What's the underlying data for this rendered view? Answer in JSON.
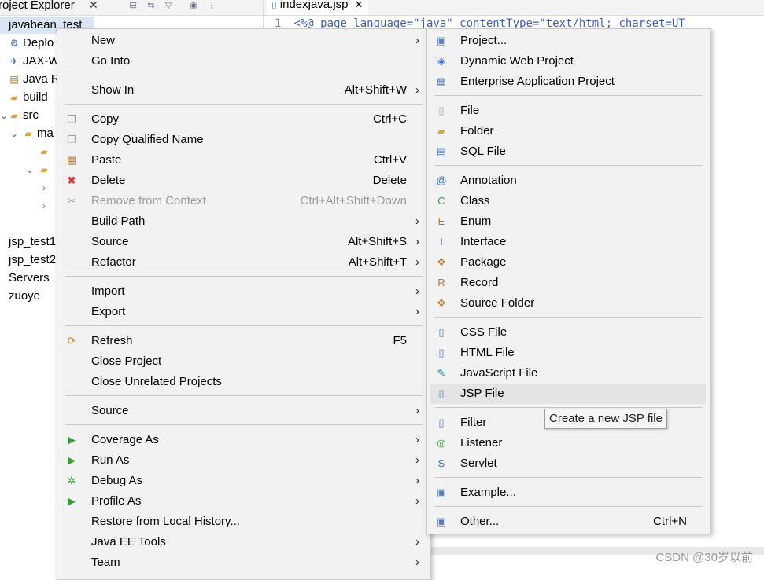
{
  "explorer": {
    "title": "roject Explorer",
    "close": "✕",
    "tree": [
      {
        "label": "javabean_test",
        "icon": "project-icon",
        "glyph": "▣",
        "selected": true
      },
      {
        "label": "Deplo",
        "icon": "deployment-icon",
        "glyph": "⚙"
      },
      {
        "label": "JAX-W",
        "icon": "webservice-icon",
        "glyph": "✈"
      },
      {
        "label": "Java R",
        "icon": "library-icon",
        "glyph": "▤"
      },
      {
        "label": "build",
        "icon": "folder-icon",
        "glyph": "▰"
      },
      {
        "label": "src",
        "icon": "folder-icon",
        "glyph": "▰"
      },
      {
        "label": "ma",
        "icon": "folder-icon",
        "glyph": "▰"
      },
      {
        "label": "",
        "icon": "folder-icon",
        "glyph": "▰"
      },
      {
        "label": "",
        "icon": "folder-icon",
        "glyph": "▰"
      },
      {
        "label": "jsp_test1",
        "icon": "project-icon",
        "glyph": ""
      },
      {
        "label": "jsp_test2",
        "icon": "project-icon",
        "glyph": ""
      },
      {
        "label": "Servers",
        "icon": "servers-icon",
        "glyph": ""
      },
      {
        "label": "zuoye",
        "icon": "project-icon",
        "glyph": ""
      }
    ]
  },
  "editor": {
    "tab_label": "indexjava.jsp",
    "tab_close": "✕",
    "line_number": "1",
    "code_line": "<%@ page language=\"java\" contentType=\"text/html; charset=UT"
  },
  "context_menu": {
    "items": [
      {
        "label": "New",
        "shortcut": "",
        "submenu": true,
        "icon": "",
        "glyph": ""
      },
      {
        "label": "Go Into",
        "shortcut": "",
        "submenu": false,
        "icon": "",
        "glyph": ""
      },
      {
        "label": "Show In",
        "shortcut": "Alt+Shift+W",
        "submenu": true,
        "icon": "",
        "glyph": ""
      },
      {
        "label": "Copy",
        "shortcut": "Ctrl+C",
        "submenu": false,
        "icon": "copy-icon",
        "glyph": "❐"
      },
      {
        "label": "Copy Qualified Name",
        "shortcut": "",
        "submenu": false,
        "icon": "copy-qualified-icon",
        "glyph": "❐"
      },
      {
        "label": "Paste",
        "shortcut": "Ctrl+V",
        "submenu": false,
        "icon": "paste-icon",
        "glyph": "▦"
      },
      {
        "label": "Delete",
        "shortcut": "Delete",
        "submenu": false,
        "icon": "delete-icon",
        "glyph": "✖"
      },
      {
        "label": "Remove from Context",
        "shortcut": "Ctrl+Alt+Shift+Down",
        "submenu": false,
        "icon": "remove-context-icon",
        "glyph": "✂",
        "disabled": true
      },
      {
        "label": "Build Path",
        "shortcut": "",
        "submenu": true,
        "icon": "",
        "glyph": ""
      },
      {
        "label": "Source",
        "shortcut": "Alt+Shift+S",
        "submenu": true,
        "icon": "",
        "glyph": ""
      },
      {
        "label": "Refactor",
        "shortcut": "Alt+Shift+T",
        "submenu": true,
        "icon": "",
        "glyph": ""
      },
      {
        "label": "Import",
        "shortcut": "",
        "submenu": true,
        "icon": "",
        "glyph": ""
      },
      {
        "label": "Export",
        "shortcut": "",
        "submenu": true,
        "icon": "",
        "glyph": ""
      },
      {
        "label": "Refresh",
        "shortcut": "F5",
        "submenu": false,
        "icon": "refresh-icon",
        "glyph": "⟳"
      },
      {
        "label": "Close Project",
        "shortcut": "",
        "submenu": false,
        "icon": "",
        "glyph": ""
      },
      {
        "label": "Close Unrelated Projects",
        "shortcut": "",
        "submenu": false,
        "icon": "",
        "glyph": ""
      },
      {
        "label": "Source",
        "shortcut": "",
        "submenu": true,
        "icon": "",
        "glyph": ""
      },
      {
        "label": "Coverage As",
        "shortcut": "",
        "submenu": true,
        "icon": "coverage-icon",
        "glyph": "▶"
      },
      {
        "label": "Run As",
        "shortcut": "",
        "submenu": true,
        "icon": "run-icon",
        "glyph": "▶"
      },
      {
        "label": "Debug As",
        "shortcut": "",
        "submenu": true,
        "icon": "debug-icon",
        "glyph": "✲"
      },
      {
        "label": "Profile As",
        "shortcut": "",
        "submenu": true,
        "icon": "profile-icon",
        "glyph": "▶"
      },
      {
        "label": "Restore from Local History...",
        "shortcut": "",
        "submenu": false,
        "icon": "",
        "glyph": ""
      },
      {
        "label": "Java EE Tools",
        "shortcut": "",
        "submenu": true,
        "icon": "",
        "glyph": ""
      },
      {
        "label": "Team",
        "shortcut": "",
        "submenu": true,
        "icon": "",
        "glyph": ""
      }
    ]
  },
  "new_submenu": {
    "items": [
      {
        "label": "Project...",
        "shortcut": "",
        "icon": "new-project-icon",
        "glyph": "▣"
      },
      {
        "label": "Dynamic Web Project",
        "shortcut": "",
        "icon": "web-project-icon",
        "glyph": "◈"
      },
      {
        "label": "Enterprise Application Project",
        "shortcut": "",
        "icon": "ear-project-icon",
        "glyph": "▦"
      },
      {
        "label": "File",
        "shortcut": "",
        "icon": "file-icon",
        "glyph": "▯"
      },
      {
        "label": "Folder",
        "shortcut": "",
        "icon": "folder-icon",
        "glyph": "▰"
      },
      {
        "label": "SQL File",
        "shortcut": "",
        "icon": "sql-file-icon",
        "glyph": "▤"
      },
      {
        "label": "Annotation",
        "shortcut": "",
        "icon": "annotation-icon",
        "glyph": "@"
      },
      {
        "label": "Class",
        "shortcut": "",
        "icon": "class-icon",
        "glyph": "C"
      },
      {
        "label": "Enum",
        "shortcut": "",
        "icon": "enum-icon",
        "glyph": "E"
      },
      {
        "label": "Interface",
        "shortcut": "",
        "icon": "interface-icon",
        "glyph": "I"
      },
      {
        "label": "Package",
        "shortcut": "",
        "icon": "package-icon",
        "glyph": "✥"
      },
      {
        "label": "Record",
        "shortcut": "",
        "icon": "record-icon",
        "glyph": "R"
      },
      {
        "label": "Source Folder",
        "shortcut": "",
        "icon": "source-folder-icon",
        "glyph": "✥"
      },
      {
        "label": "CSS File",
        "shortcut": "",
        "icon": "css-file-icon",
        "glyph": "▯"
      },
      {
        "label": "HTML File",
        "shortcut": "",
        "icon": "html-file-icon",
        "glyph": "▯"
      },
      {
        "label": "JavaScript File",
        "shortcut": "",
        "icon": "javascript-file-icon",
        "glyph": "✎"
      },
      {
        "label": "JSP File",
        "shortcut": "",
        "icon": "jsp-file-icon",
        "glyph": "▯",
        "highlighted": true
      },
      {
        "label": "Filter",
        "shortcut": "",
        "icon": "filter-icon",
        "glyph": "▯"
      },
      {
        "label": "Listener",
        "shortcut": "",
        "icon": "listener-icon",
        "glyph": "◎"
      },
      {
        "label": "Servlet",
        "shortcut": "",
        "icon": "servlet-icon",
        "glyph": "S"
      },
      {
        "label": "Example...",
        "shortcut": "",
        "icon": "example-icon",
        "glyph": "▣"
      },
      {
        "label": "Other...",
        "shortcut": "Ctrl+N",
        "icon": "other-icon",
        "glyph": "▣"
      }
    ]
  },
  "tooltip": "Create a new JSP file",
  "watermark": "CSDN @30岁以前",
  "colors": {
    "menu_bg": "#f2f2f2",
    "highlight": "#e4e4e4",
    "selection": "#d9e6f6"
  }
}
